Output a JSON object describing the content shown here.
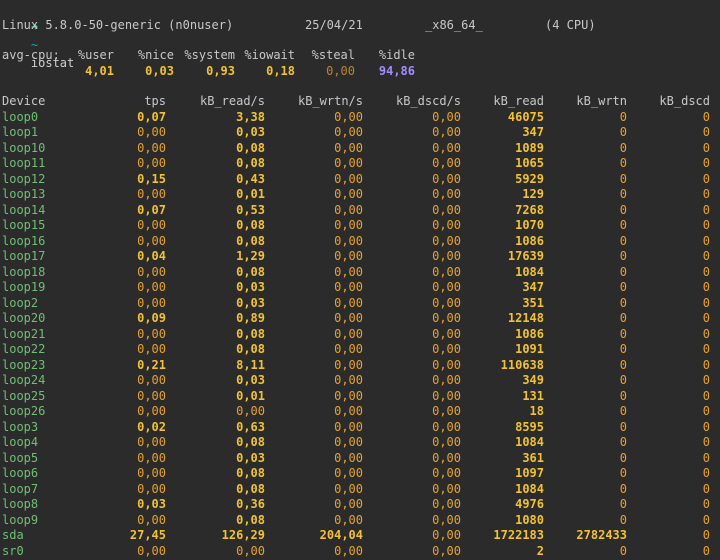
{
  "prompt": {
    "arrow": "➜",
    "dir": "~",
    "command": "iostat"
  },
  "sysinfo": {
    "kernel": "Linux 5.8.0-50-generic (n0nuser)",
    "date": "25/04/21",
    "arch": "_x86_64_",
    "cpus": "(4 CPU)"
  },
  "cpu": {
    "label": "avg-cpu:",
    "headers": [
      "%user",
      "%nice",
      "%system",
      "%iowait",
      "%steal",
      "%idle"
    ],
    "values": [
      "4,01",
      "0,03",
      "0,93",
      "0,18",
      "0,00",
      "94,86"
    ]
  },
  "table": {
    "headers": [
      "Device",
      "tps",
      "kB_read/s",
      "kB_wrtn/s",
      "kB_dscd/s",
      "kB_read",
      "kB_wrtn",
      "kB_dscd"
    ],
    "rows": [
      [
        "loop0",
        "0,07",
        "3,38",
        "0,00",
        "0,00",
        "46075",
        "0",
        "0"
      ],
      [
        "loop1",
        "0,00",
        "0,03",
        "0,00",
        "0,00",
        "347",
        "0",
        "0"
      ],
      [
        "loop10",
        "0,00",
        "0,08",
        "0,00",
        "0,00",
        "1089",
        "0",
        "0"
      ],
      [
        "loop11",
        "0,00",
        "0,08",
        "0,00",
        "0,00",
        "1065",
        "0",
        "0"
      ],
      [
        "loop12",
        "0,15",
        "0,43",
        "0,00",
        "0,00",
        "5929",
        "0",
        "0"
      ],
      [
        "loop13",
        "0,00",
        "0,01",
        "0,00",
        "0,00",
        "129",
        "0",
        "0"
      ],
      [
        "loop14",
        "0,07",
        "0,53",
        "0,00",
        "0,00",
        "7268",
        "0",
        "0"
      ],
      [
        "loop15",
        "0,00",
        "0,08",
        "0,00",
        "0,00",
        "1070",
        "0",
        "0"
      ],
      [
        "loop16",
        "0,00",
        "0,08",
        "0,00",
        "0,00",
        "1086",
        "0",
        "0"
      ],
      [
        "loop17",
        "0,04",
        "1,29",
        "0,00",
        "0,00",
        "17639",
        "0",
        "0"
      ],
      [
        "loop18",
        "0,00",
        "0,08",
        "0,00",
        "0,00",
        "1084",
        "0",
        "0"
      ],
      [
        "loop19",
        "0,00",
        "0,03",
        "0,00",
        "0,00",
        "347",
        "0",
        "0"
      ],
      [
        "loop2",
        "0,00",
        "0,03",
        "0,00",
        "0,00",
        "351",
        "0",
        "0"
      ],
      [
        "loop20",
        "0,09",
        "0,89",
        "0,00",
        "0,00",
        "12148",
        "0",
        "0"
      ],
      [
        "loop21",
        "0,00",
        "0,08",
        "0,00",
        "0,00",
        "1086",
        "0",
        "0"
      ],
      [
        "loop22",
        "0,00",
        "0,08",
        "0,00",
        "0,00",
        "1091",
        "0",
        "0"
      ],
      [
        "loop23",
        "0,21",
        "8,11",
        "0,00",
        "0,00",
        "110638",
        "0",
        "0"
      ],
      [
        "loop24",
        "0,00",
        "0,03",
        "0,00",
        "0,00",
        "349",
        "0",
        "0"
      ],
      [
        "loop25",
        "0,00",
        "0,01",
        "0,00",
        "0,00",
        "131",
        "0",
        "0"
      ],
      [
        "loop26",
        "0,00",
        "0,00",
        "0,00",
        "0,00",
        "18",
        "0",
        "0"
      ],
      [
        "loop3",
        "0,02",
        "0,63",
        "0,00",
        "0,00",
        "8595",
        "0",
        "0"
      ],
      [
        "loop4",
        "0,00",
        "0,08",
        "0,00",
        "0,00",
        "1084",
        "0",
        "0"
      ],
      [
        "loop5",
        "0,00",
        "0,03",
        "0,00",
        "0,00",
        "361",
        "0",
        "0"
      ],
      [
        "loop6",
        "0,00",
        "0,08",
        "0,00",
        "0,00",
        "1097",
        "0",
        "0"
      ],
      [
        "loop7",
        "0,00",
        "0,08",
        "0,00",
        "0,00",
        "1084",
        "0",
        "0"
      ],
      [
        "loop8",
        "0,03",
        "0,36",
        "0,00",
        "0,00",
        "4976",
        "0",
        "0"
      ],
      [
        "loop9",
        "0,00",
        "0,08",
        "0,00",
        "0,00",
        "1080",
        "0",
        "0"
      ],
      [
        "sda",
        "27,45",
        "126,29",
        "204,04",
        "0,00",
        "1722183",
        "2782433",
        "0"
      ],
      [
        "sr0",
        "0,00",
        "0,00",
        "0,00",
        "0,00",
        "2",
        "0",
        "0"
      ]
    ]
  },
  "colors": {
    "background": "#2b2b2b",
    "device": "#6fbf73",
    "nonzero": "#f2c230",
    "zero": "#e6a22e",
    "idle": "#a58cff"
  }
}
